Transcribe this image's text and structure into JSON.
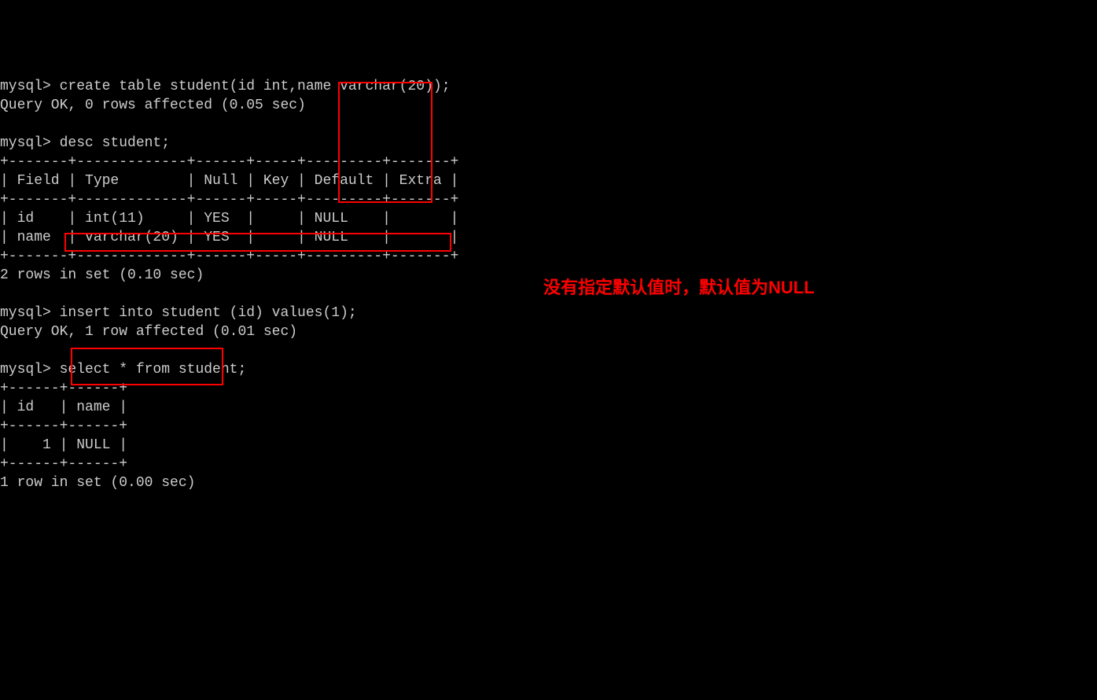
{
  "terminal": {
    "lines": [
      "mysql> create table student(id int,name varchar(20));",
      "Query OK, 0 rows affected (0.05 sec)",
      "",
      "mysql> desc student;",
      "+-------+-------------+------+-----+---------+-------+",
      "| Field | Type        | Null | Key | Default | Extra |",
      "+-------+-------------+------+-----+---------+-------+",
      "| id    | int(11)     | YES  |     | NULL    |       |",
      "| name  | varchar(20) | YES  |     | NULL    |       |",
      "+-------+-------------+------+-----+---------+-------+",
      "2 rows in set (0.10 sec)",
      "",
      "mysql> insert into student (id) values(1);",
      "Query OK, 1 row affected (0.01 sec)",
      "",
      "mysql> select * from student;",
      "+------+------+",
      "| id   | name |",
      "+------+------+",
      "|    1 | NULL |",
      "+------+------+",
      "1 row in set (0.00 sec)"
    ]
  },
  "annotation": {
    "text": "没有指定默认值时，默认值为NULL"
  }
}
